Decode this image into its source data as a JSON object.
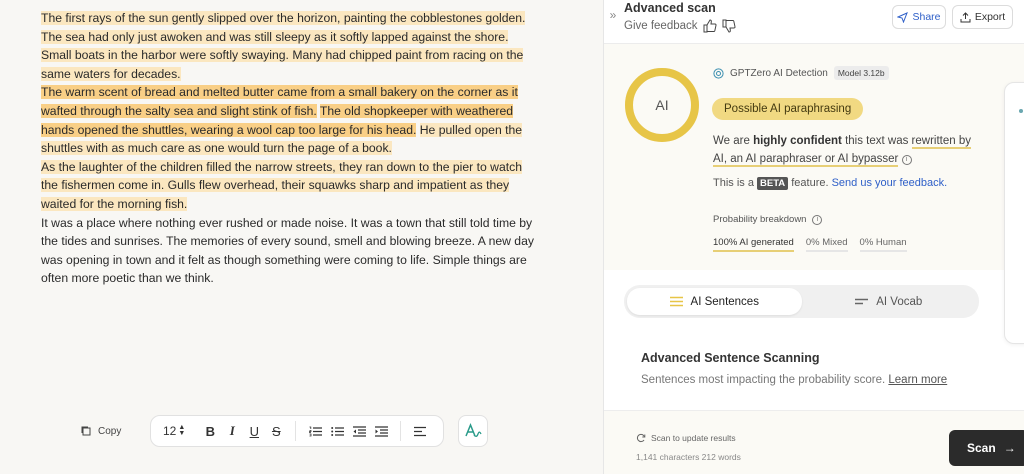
{
  "document": {
    "paragraphs": [
      [
        {
          "text": "The first rays of the sun gently slipped over the horizon, painting the cobblestones golden. The sea had only just awoken and was still sleepy as it softly lapped against the shore. Small boats in the harbor were softly swaying. Many had chipped paint from racing on the same waters for decades.",
          "hl": "light"
        }
      ],
      [
        {
          "text": "The warm scent of bread and melted butter came from a small bakery on the corner as it wafted through the salty sea and slight stink of fish.",
          "hl": "strong"
        },
        {
          "text": " ",
          "hl": ""
        },
        {
          "text": "The old shopkeeper with weathered hands opened the shuttles, wearing a wool cap too large for his head.",
          "hl": "strong"
        },
        {
          "text": " ",
          "hl": ""
        },
        {
          "text": "He pulled open the shuttles with as much care as one would turn the page of a book.",
          "hl": "light"
        }
      ],
      [
        {
          "text": "As the laughter of the children filled the narrow streets, they ran down to the pier to watch the fishermen come in. Gulls flew overhead, their squawks sharp and impatient as they waited for the morning fish.",
          "hl": "light"
        }
      ],
      [
        {
          "text": "It was a place where nothing ever rushed or made noise. It was a town that still told time by the tides and sunrises. The memories of every sound, smell and blowing breeze. A new day was opening in town and it felt as though something were coming to life. Simple things are often more poetic than we think.",
          "hl": ""
        }
      ]
    ]
  },
  "toolbar": {
    "copy_label": "Copy",
    "font_size": "12",
    "bold": "B",
    "italic": "I",
    "underline": "U",
    "strike": "S"
  },
  "panel": {
    "title": "Advanced scan",
    "give_feedback": "Give feedback",
    "share_label": "Share",
    "export_label": "Export",
    "ring_label": "AI",
    "ai_fraction": 1.0,
    "detector_label": "GPTZero AI Detection",
    "model_badge": "Model 3.12b",
    "verdict": "Possible AI paraphrasing",
    "confidence_pre": "We are ",
    "confidence_bold": "highly confident",
    "confidence_mid": " this text was ",
    "confidence_link": "rewritten by AI, an AI paraphraser or AI bypasser",
    "beta_pre": "This is a ",
    "beta_badge": "BETA",
    "beta_post": " feature. ",
    "beta_link": "Send us your feedback.",
    "prob_title": "Probability breakdown",
    "prob_ai": "100% AI generated",
    "prob_mixed": "0% Mixed",
    "prob_human": "0% Human",
    "tab_sentences": "AI Sentences",
    "tab_vocab": "AI Vocab",
    "scan_title": "Advanced Sentence Scanning",
    "scan_desc": "Sentences most impacting the probability score.",
    "learn_more": "Learn more",
    "update_label": "Scan to update results",
    "counts": "1,141 characters 212 words",
    "scan_button": "Scan"
  },
  "colors": {
    "highlight_light": "#fbe7c0",
    "highlight_strong": "#f9cf86",
    "ring": "#e7c547",
    "verdict_bg": "#f1d982",
    "link": "#2e5fc8"
  }
}
